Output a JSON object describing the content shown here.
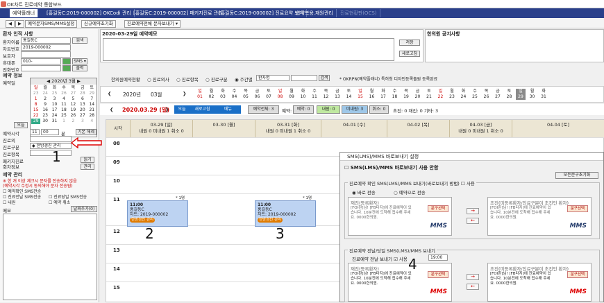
{
  "window": {
    "title": "OK차트 진료예약 통합보드"
  },
  "tabs": [
    {
      "label": "예약플래너",
      "active": true
    },
    {
      "label": "[홍길동C:2019-000002] OKCodi 관리"
    },
    {
      "label": "[홍길동C:2019-000002] 패키지진료 관리"
    },
    {
      "label": "[홍길동C:2019-000002] 진료요약 보기"
    },
    {
      "label": "한약복용.재원관리"
    },
    {
      "label": "진료현황판(OCS)",
      "dim": true
    }
  ],
  "toolbar": {
    "nav_prev": "◀",
    "nav_next": "▶",
    "btn_sms": "예약문자SMS/MMS설정",
    "btn_new": "신규예약초기화",
    "btn_all": "진료예약전체 문자보내기 ▾"
  },
  "patient": {
    "section_title": "환자 인적 사항",
    "name_label": "환자이름",
    "name_value": "홍길동C",
    "search_btn": "검색",
    "chart_label": "차트번호",
    "chart_value": "2019-000002",
    "guardian_label": "보호자",
    "mobile_label": "휴대폰",
    "mobile_value": "010-",
    "sms_btn": "SMS ▾",
    "home_label": "전화번호",
    "print_btn": "출력"
  },
  "reservation": {
    "section_title": "예약 정보",
    "date_label": "예약일",
    "cal_title": "2020년 3월",
    "cal_weekdays": [
      "일",
      "월",
      "화",
      "수",
      "목",
      "금",
      "토"
    ],
    "today_btn": "오늘",
    "time_label": "예약시각",
    "hour": "11",
    "min": "00",
    "min_unit": "분",
    "default_btn": "기본 해제",
    "doctor_label": "진료의",
    "type_label": "진료구분",
    "type_value": "◆ 한방경진 관리",
    "item_label": "진료항목",
    "package_label": "패키지진료",
    "package_label2": "회차정보",
    "read_btn": "읽기",
    "manage_btn": "관리"
  },
  "reservation_mgmt": {
    "section_title": "예약 관리",
    "warn1": "※ 한 개 이상 체크시 문자를 전송하지 않음",
    "warn2": "(예약시각 수정시 동의해야 문자 전송됨)",
    "chk1": "예약확인 SMS전송",
    "chk2": "진료전날 SMS전송",
    "chk3": "진료당일 SMS전송",
    "chk4": "내원",
    "chk5": "예약 취소",
    "memo_label": "메모",
    "history_btn": "날짜추가(0)"
  },
  "memo_panel": {
    "title": "2020-03-29일 예약메모",
    "save_btn": "저장",
    "refresh_btn": "새로고침"
  },
  "notice_panel": {
    "title": "한의원 공지사항"
  },
  "filter": {
    "status_label": "한의원예약현황",
    "radio1": "진료의사",
    "radio2": "진료항목",
    "radio3": "진료구분",
    "radio4": "주간별",
    "patient_placeholder": "환자명",
    "search_btn": "검색",
    "note": "* OKRPN(예약플래너) 특허청 디자인등록출원 등록완료"
  },
  "date_strip": {
    "year": "2020년",
    "month": "03월",
    "days": [
      {
        "w": "일",
        "d": "01"
      },
      {
        "w": "월",
        "d": "02"
      },
      {
        "w": "화",
        "d": "03"
      },
      {
        "w": "수",
        "d": "04"
      },
      {
        "w": "목",
        "d": "05"
      },
      {
        "w": "금",
        "d": "06"
      },
      {
        "w": "토",
        "d": "07"
      },
      {
        "w": "일",
        "d": "08"
      },
      {
        "w": "월",
        "d": "09"
      },
      {
        "w": "화",
        "d": "10"
      },
      {
        "w": "수",
        "d": "11"
      },
      {
        "w": "목",
        "d": "12"
      },
      {
        "w": "금",
        "d": "13"
      },
      {
        "w": "토",
        "d": "14"
      },
      {
        "w": "일",
        "d": "15"
      },
      {
        "w": "월",
        "d": "16"
      },
      {
        "w": "화",
        "d": "17"
      },
      {
        "w": "수",
        "d": "18"
      },
      {
        "w": "목",
        "d": "19"
      },
      {
        "w": "금",
        "d": "20"
      },
      {
        "w": "토",
        "d": "21"
      },
      {
        "w": "일",
        "d": "22"
      },
      {
        "w": "월",
        "d": "23"
      },
      {
        "w": "화",
        "d": "24"
      },
      {
        "w": "수",
        "d": "25"
      },
      {
        "w": "목",
        "d": "26"
      },
      {
        "w": "금",
        "d": "27"
      },
      {
        "w": "토",
        "d": "28"
      },
      {
        "w": "일",
        "d": "29",
        "sel": true
      },
      {
        "w": "월",
        "d": "30"
      },
      {
        "w": "화",
        "d": "31"
      }
    ]
  },
  "date_nav": {
    "current": "2020.03.29 (일)",
    "today_btn": "오늘",
    "refresh_btn": "새로고침",
    "menu_btn": "메뉴",
    "stats": [
      {
        "label": "예약전체: 3"
      },
      {
        "label": "예약: 0"
      },
      {
        "label": "내원: 0"
      },
      {
        "label": "미내원: 3"
      },
      {
        "label": "취소: 0"
      }
    ],
    "summary": "초진: 0  재진: 0  기타: 3"
  },
  "schedule": {
    "time_col": "시각",
    "columns": [
      {
        "date": "03-29 [일]",
        "sub": "내원 0 미내원 1 취소 0"
      },
      {
        "date": "03-30 [월]",
        "sub": ""
      },
      {
        "date": "03-31 [화]",
        "sub": "내원 0 미내원 1 취소 0"
      },
      {
        "date": "04-01 [수]",
        "sub": ""
      },
      {
        "date": "04-02 [목]",
        "sub": ""
      },
      {
        "date": "04-03 [금]",
        "sub": "내원 0 미내원 1 취소 0"
      },
      {
        "date": "04-04 [토]",
        "sub": ""
      }
    ],
    "hours": [
      "08",
      "09",
      "10",
      "11",
      "12",
      "13",
      "14",
      "15"
    ],
    "appts": [
      {
        "time": "11:00",
        "name": "홍길동C",
        "chart": "차트: 2019-000002",
        "badge": "한방경진 관리"
      },
      {
        "time": "11:00",
        "name": "홍길동C",
        "chart": "차트: 2019-000002",
        "badge": "한방경진 관리"
      }
    ],
    "count_tag": "* 1명"
  },
  "annotations": {
    "n1": "1",
    "n2": "2",
    "n3": "3",
    "n4": "4"
  },
  "dialog": {
    "title": "SMS(LMS)/MMS 바로보내기 설정",
    "top_check": "SMS(LMS)/MMS 바로보내기 사용 안함",
    "reset_btn": "모든문구초기화",
    "g1_title": "진료예약 확인 SMS(LMS)/MMS 보내기(바로보내기 방법)",
    "g1_use": "사용",
    "g1_radio1": "바로 전송",
    "g1_radio2": "예약으로 전송",
    "g2_title": "진료예약 전날/당일 SMS(LMS)/MMS 보내기",
    "g2_sub": "진료예약 전날 보내기",
    "g2_use": "사용",
    "g2_time": "19:00",
    "box_revisit": "재진(등록환자)",
    "box_first": "초진(미등록환자/진료구분이 초진인 환자)",
    "msg_text": "[FOI환]님! [FB타지]에 진료예약이 있습니다. 10분전에 도착해 접수해 주세요. 0000한의원.",
    "select_btn": "문구선택",
    "mms": "MMS"
  }
}
